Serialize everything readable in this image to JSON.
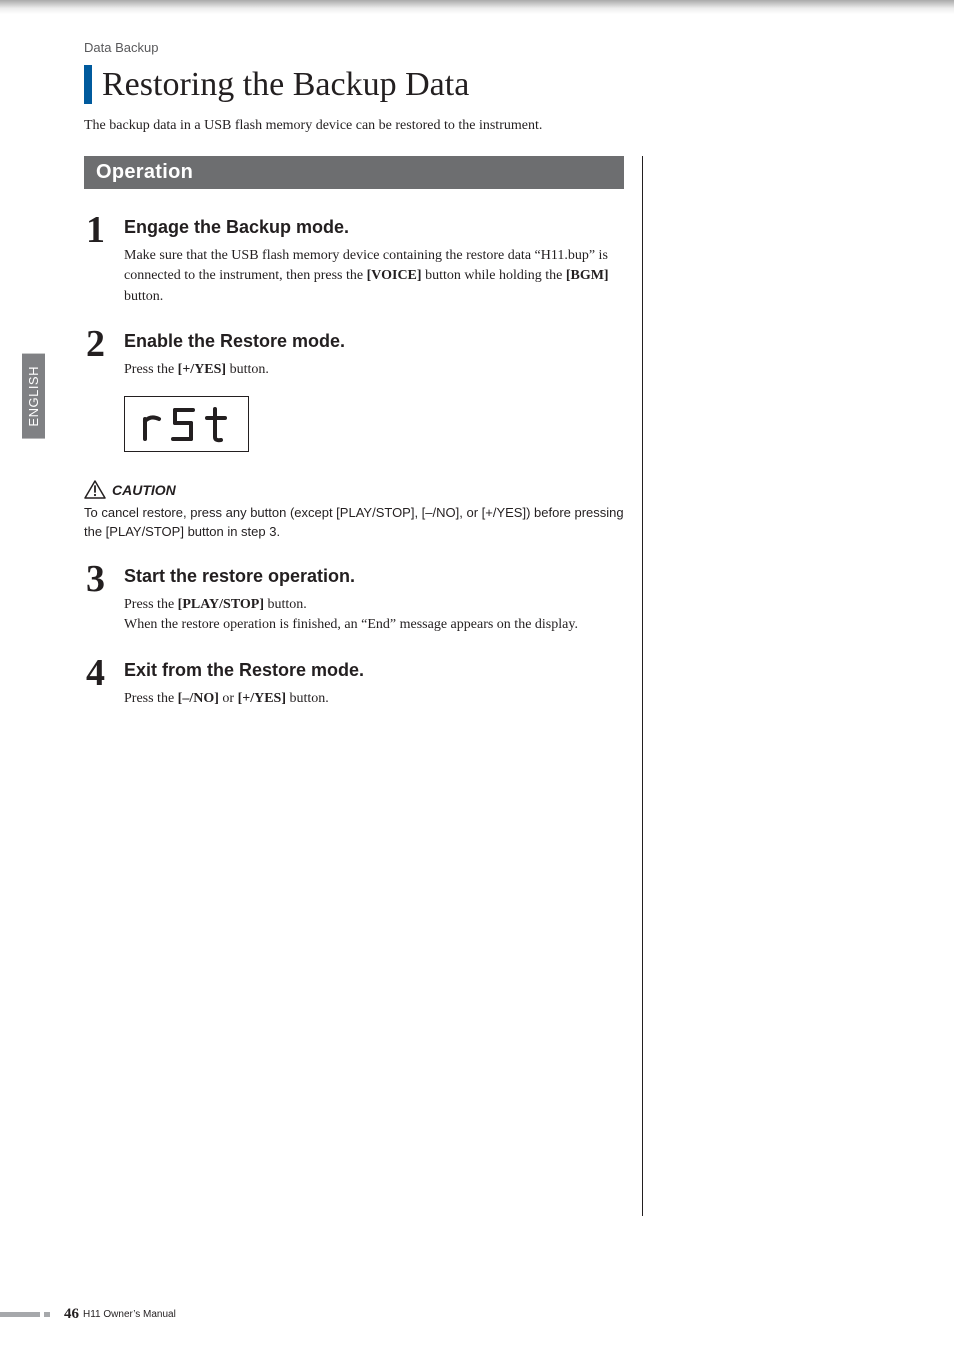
{
  "lang_tab": "ENGLISH",
  "header_line": "Data Backup",
  "main_title": "Restoring the Backup Data",
  "intro": "The backup data in a USB flash memory device can be restored to the instrument.",
  "op_bar": "Operation",
  "steps": {
    "s1_num": "1",
    "s1_title": "Engage the Backup mode.",
    "s1_text_a": "Make sure that the USB flash memory device containing the restore data “H11.bup” is connected to the instrument, then press the ",
    "s1_text_b": "[VOICE]",
    "s1_text_c": " button while holding the ",
    "s1_text_d": "[BGM]",
    "s1_text_e": " button.",
    "s2_num": "2",
    "s2_title": "Enable the Restore mode.",
    "s2_text_a": "Press the ",
    "s2_text_b": "[+/YES]",
    "s2_text_c": " button.",
    "s3_num": "3",
    "s3_title": "Start the restore operation.",
    "s3_text_a": "Press the ",
    "s3_text_b": "[PLAY/STOP]",
    "s3_text_c": " button.",
    "s3_text_d": "When the restore operation is finished, an “End” message appears on the display.",
    "s4_num": "4",
    "s4_title": "Exit from the Restore mode.",
    "s4_text_a": "Press the ",
    "s4_text_b": "[–/NO]",
    "s4_text_c": " or ",
    "s4_text_d": "[+/YES]",
    "s4_text_e": " button."
  },
  "caution_label": "CAUTION",
  "caution_text": "To cancel restore, press any button (except [PLAY/STOP], [–/NO], or [+/YES]) before pressing the [PLAY/STOP] button in step 3.",
  "footer": {
    "page_num": "46",
    "manual": "H11 Owner’s Manual"
  }
}
